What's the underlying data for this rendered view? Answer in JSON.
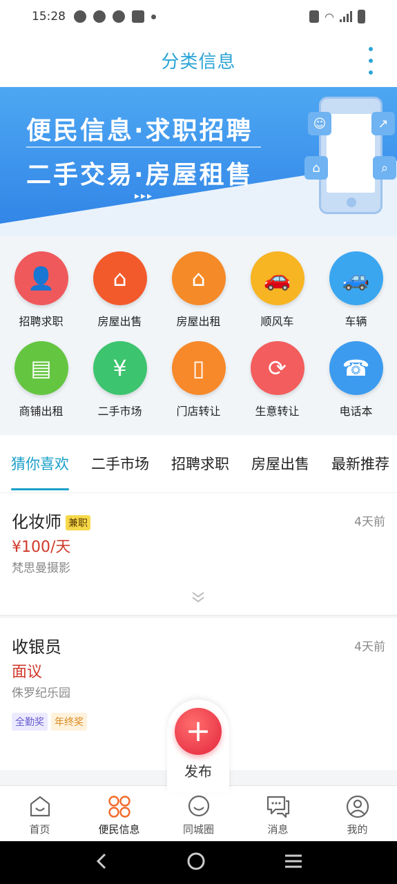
{
  "status_bar": {
    "time": "15:28"
  },
  "header": {
    "title": "分类信息"
  },
  "banner": {
    "line1": "便民信息·求职招聘",
    "line2": "二手交易·房屋租售",
    "dots": "▸▸▸"
  },
  "categories": [
    {
      "label": "招聘求职",
      "color": "#f0595c",
      "icon": "person-icon"
    },
    {
      "label": "房屋出售",
      "color": "#f25a2c",
      "icon": "house-icon"
    },
    {
      "label": "房屋出租",
      "color": "#f58a28",
      "icon": "rent-house-icon"
    },
    {
      "label": "顺风车",
      "color": "#f7b423",
      "icon": "car-icon"
    },
    {
      "label": "车辆",
      "color": "#3aa6f0",
      "icon": "car-yen-icon"
    },
    {
      "label": "商铺出租",
      "color": "#64c541",
      "icon": "shop-icon"
    },
    {
      "label": "二手市场",
      "color": "#3dc46e",
      "icon": "yen-cycle-icon"
    },
    {
      "label": "门店转让",
      "color": "#f7892a",
      "icon": "door-icon"
    },
    {
      "label": "生意转让",
      "color": "#f35d5d",
      "icon": "transfer-icon"
    },
    {
      "label": "电话本",
      "color": "#3c9bef",
      "icon": "phone-icon"
    }
  ],
  "tabs": [
    "猜你喜欢",
    "二手市场",
    "招聘求职",
    "房屋出售",
    "最新推荐"
  ],
  "feed": [
    {
      "title": "化妆师",
      "badge": "兼职",
      "time": "4天前",
      "salary": "¥100/天",
      "company": "梵思曼摄影",
      "tags": []
    },
    {
      "title": "收银员",
      "badge": "",
      "time": "4天前",
      "salary": "面议",
      "company": "侏罗纪乐园",
      "tags": [
        "全勤奖",
        "年终奖"
      ]
    }
  ],
  "publish": {
    "label": "发布"
  },
  "bottom_nav": [
    {
      "label": "首页",
      "icon": "home-icon"
    },
    {
      "label": "便民信息",
      "icon": "grid-icon"
    },
    {
      "label": "同城圈",
      "icon": "smile-icon"
    },
    {
      "label": "消息",
      "icon": "chat-icon"
    },
    {
      "label": "我的",
      "icon": "user-icon"
    }
  ],
  "colors": {
    "accent": "#1a9fc8",
    "price": "#d0392b",
    "publish": "#e3253c"
  }
}
